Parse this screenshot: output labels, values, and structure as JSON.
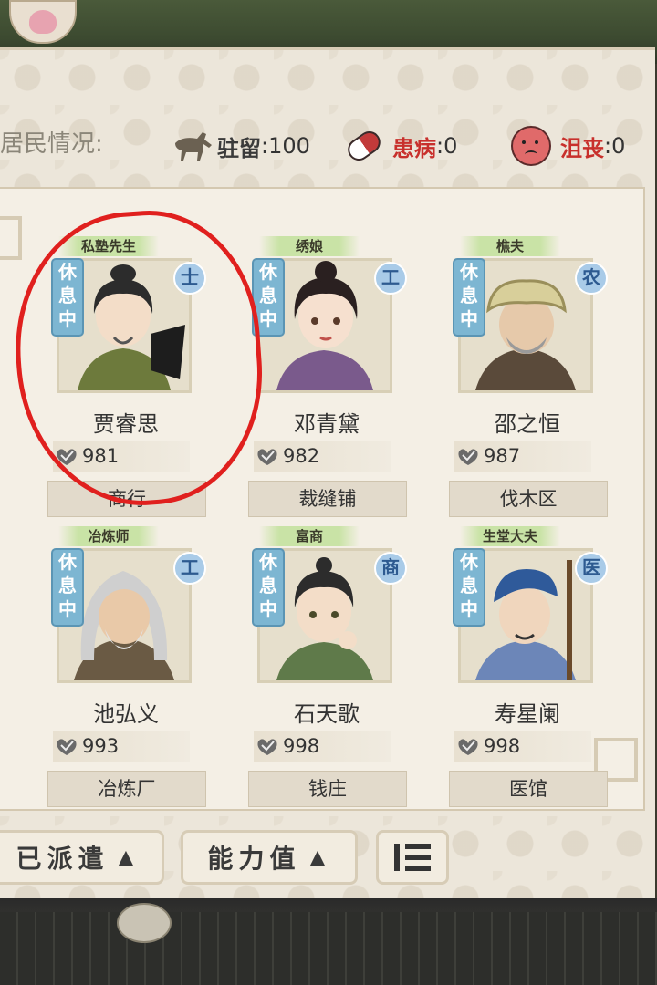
{
  "header": {
    "title": "居民情况:",
    "stats": [
      {
        "icon": "horse-icon",
        "label": "驻留",
        "value": ":100",
        "color": "#3b3b3b"
      },
      {
        "icon": "pill-icon",
        "label": "患病",
        "value": ":0",
        "color": "#c8302c"
      },
      {
        "icon": "sad-face-icon",
        "label": "沮丧",
        "value": ":0",
        "color": "#c8302c"
      }
    ]
  },
  "residents": [
    {
      "role": "私塾先生",
      "status": "休息中",
      "class": "士",
      "name": "贾睿思",
      "power": "981",
      "workplace": "商行"
    },
    {
      "role": "绣娘",
      "status": "休息中",
      "class": "工",
      "name": "邓青黛",
      "power": "982",
      "workplace": "裁缝铺"
    },
    {
      "role": "樵夫",
      "status": "休息中",
      "class": "农",
      "name": "邵之恒",
      "power": "987",
      "workplace": "伐木区"
    },
    {
      "role": "冶炼师",
      "status": "休息中",
      "class": "工",
      "name": "池弘义",
      "power": "993",
      "workplace": "冶炼厂"
    },
    {
      "role": "富商",
      "status": "休息中",
      "class": "商",
      "name": "石天歌",
      "power": "998",
      "workplace": "钱庄"
    },
    {
      "role": "生堂大夫",
      "status": "休息中",
      "class": "医",
      "name": "寿星阑",
      "power": "998",
      "workplace": "医馆"
    }
  ],
  "footer": {
    "sort_dispatched": "已派遣",
    "sort_ability": "能力值",
    "list_icon": "list-toggle-icon"
  }
}
